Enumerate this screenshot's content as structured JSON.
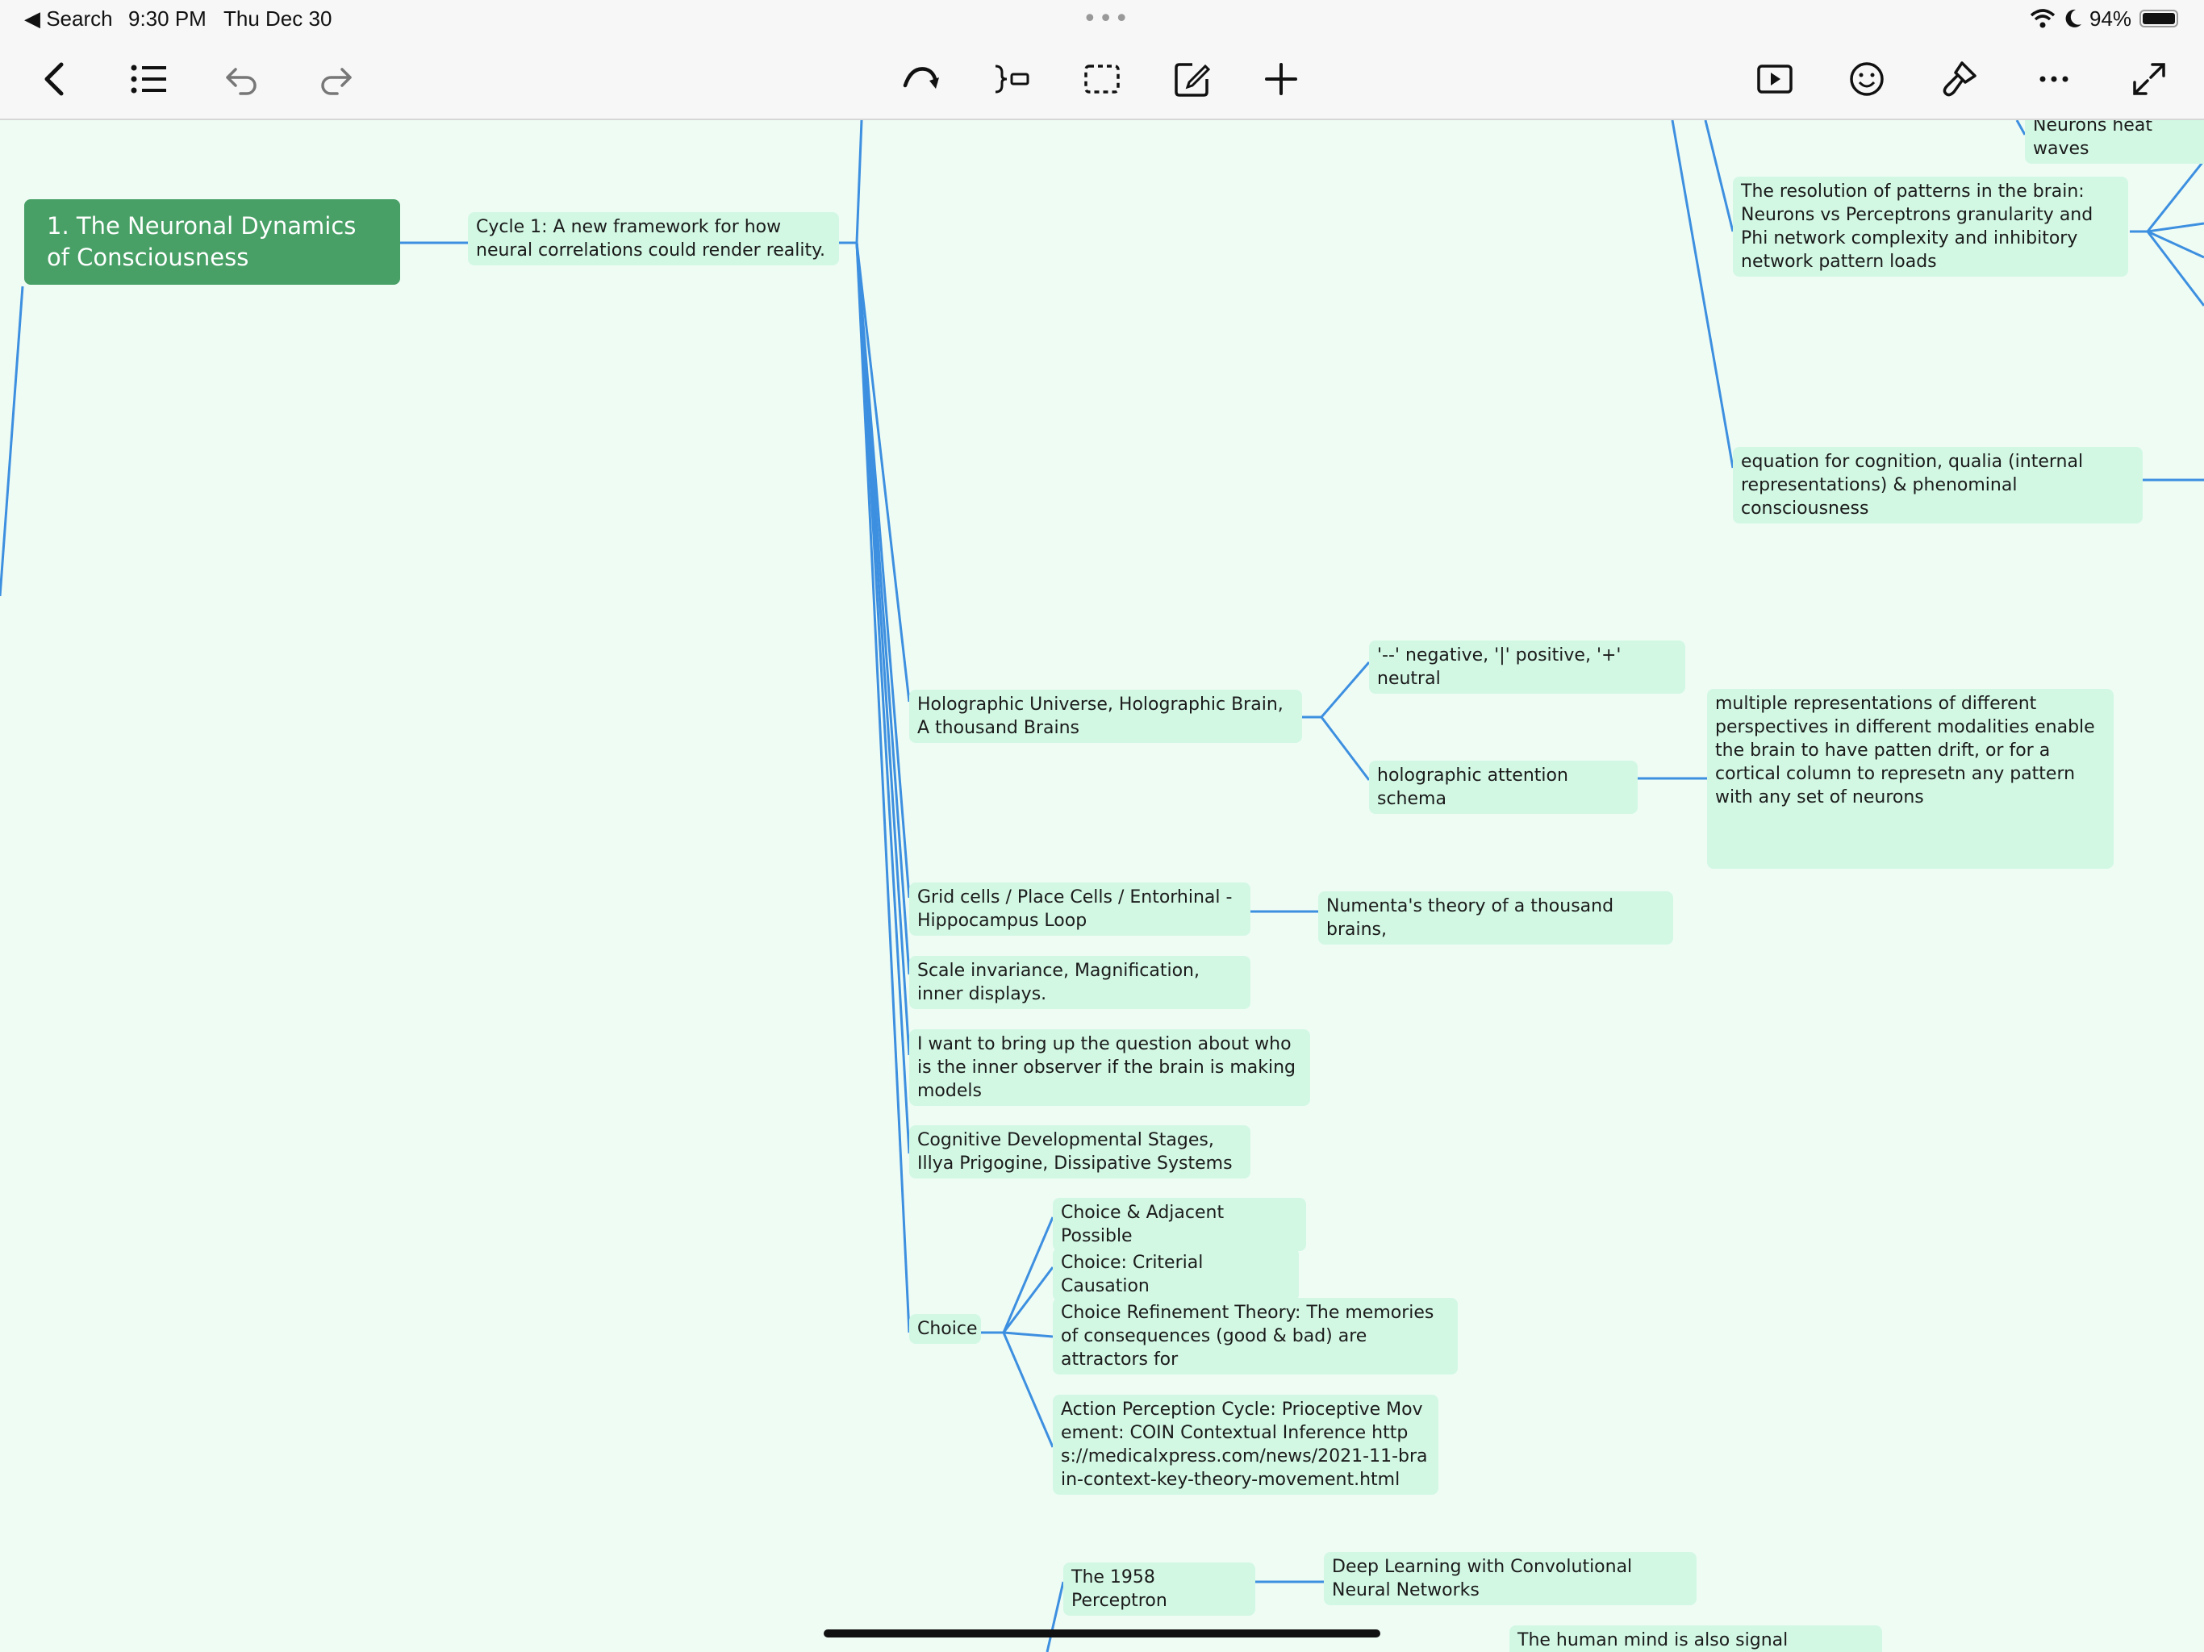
{
  "status_bar": {
    "back_app": "◀ Search",
    "time": "9:30 PM",
    "date": "Thu Dec 30",
    "battery": "94%"
  },
  "toolbar": {
    "left": [
      "back",
      "outline",
      "undo",
      "redo"
    ],
    "center": [
      "reorganize",
      "topic",
      "boundary",
      "edit-note",
      "add"
    ],
    "right": [
      "present",
      "sticker",
      "format",
      "more",
      "fullscreen"
    ]
  },
  "mindmap": {
    "root": "1. The Neuronal Dynamics of Consciousness",
    "cycle": "Cycle 1: A new framework for how neural correlations could render reality.",
    "top_right": {
      "neurons_heat": "Neurons heat waves",
      "resolution": "The resolution of patterns in the brain: Neurons vs Perceptrons granularity and Phi network complexity and inhibitory network pattern loads",
      "equation": "equation for cognition, qualia (internal representations) & phenominal consciousness"
    },
    "holographic": {
      "label": "Holographic Universe, Holographic Brain, A thousand Brains",
      "negpos": "'--' negative, '|' positive, '+' neutral",
      "attention": "holographic attention schema",
      "multiple": "multiple representations of different perspectives in different modalities enable the brain to have patten drift, or for a cortical column to represetn any pattern with any set of neurons"
    },
    "grid": {
      "label": "Grid cells / Place Cells / Entorhinal - Hippocampus Loop",
      "numenta": "Numenta's theory of a thousand brains,"
    },
    "scale": "Scale invariance, Magnification, inner displays.",
    "observer": "I want to bring up the question about who is the inner observer if the brain is making models",
    "cognitive": "Cognitive Developmental Stages, Illya Prigogine, Dissipative Systems",
    "choice": {
      "label": "Choice",
      "adjacent": "Choice & Adjacent Possible",
      "criterial": "Choice: Criterial Causation",
      "refinement": "Choice Refinement Theory: The memories of consequences (good & bad) are attractors for",
      "action": "Action Perception Cycle: Prioceptive Movement: COIN Contextual Inference https://medicalxpress.com/news/2021-11-brain-context-key-theory-movement.html"
    },
    "perceptron": {
      "label": "The 1958 Perceptron",
      "deep": "Deep Learning with Convolutional Neural Networks",
      "signal": "The human mind is also signal processor."
    }
  },
  "colors": {
    "canvas": "#effcf4",
    "node": "#d2f8e4",
    "root": "#48a066",
    "connector": "#3d8fe0"
  }
}
